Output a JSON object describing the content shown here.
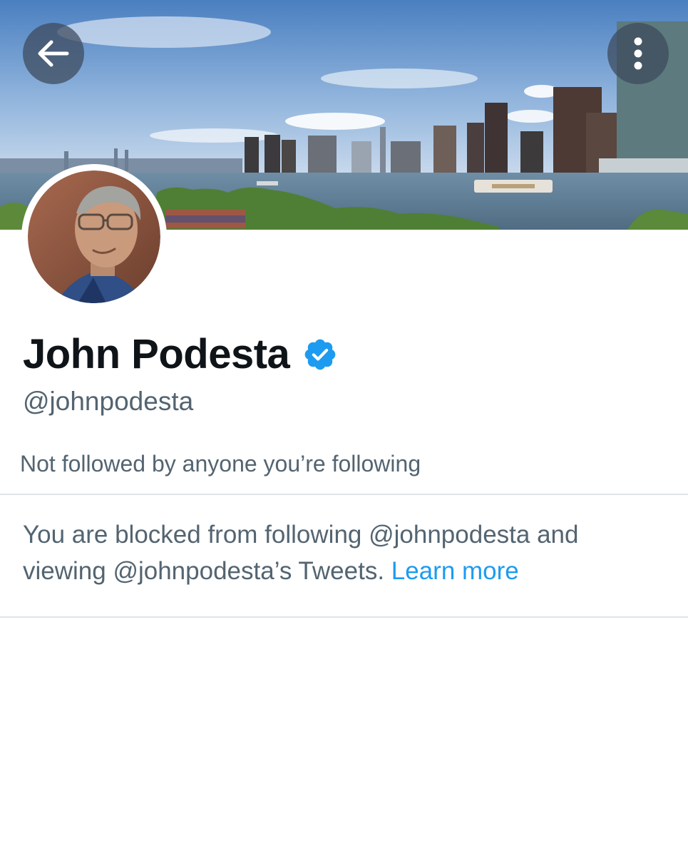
{
  "header": {
    "back_icon": "arrow-left-icon",
    "more_icon": "more-vertical-icon"
  },
  "profile": {
    "display_name": "John Podesta",
    "verified_icon": "verified-badge-icon",
    "verified_color": "#1d9bf0",
    "handle": "@johnpodesta",
    "followers_note": "Not followed by anyone you’re following"
  },
  "blocked_notice": {
    "message": "You are blocked from following @johnpodesta and viewing @johnpodesta’s Tweets.",
    "learn_more": "Learn more",
    "link_color": "#1d9bf0"
  }
}
